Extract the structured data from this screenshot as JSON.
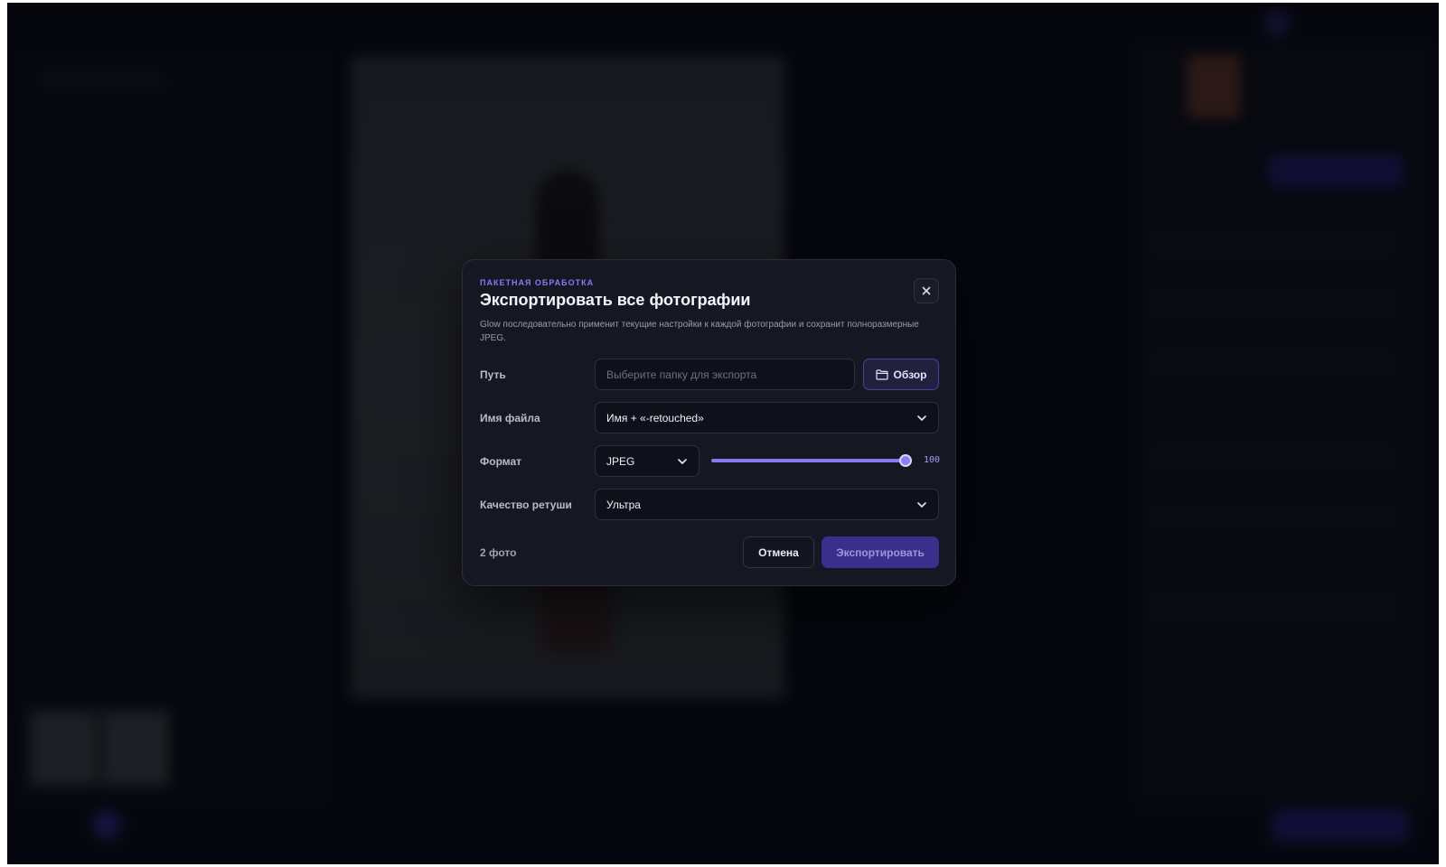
{
  "modal": {
    "eyebrow": "ПАКЕТНАЯ ОБРАБОТКА",
    "title": "Экспортировать все фотографии",
    "description": "Glow последовательно применит текущие настройки к каждой фотографии и сохранит полноразмерные JPEG.",
    "close_icon": "close-icon",
    "path": {
      "label": "Путь",
      "value": "",
      "placeholder": "Выберите папку для экспорта",
      "browse_label": "Обзор",
      "browse_icon": "folder-icon"
    },
    "filename": {
      "label": "Имя файла",
      "selected": "Имя + «-retouched»"
    },
    "format": {
      "label": "Формат",
      "selected": "JPEG",
      "quality_value": "100",
      "quality_fraction": 1.0
    },
    "retouch_quality": {
      "label": "Качество ретуши",
      "selected": "Ультра"
    },
    "footer": {
      "count": "2 фото",
      "cancel_label": "Отмена",
      "export_label": "Экспортировать"
    }
  },
  "colors": {
    "accent": "#8a78f0",
    "primary_button": "#3a2f8c",
    "modal_bg": "#151722",
    "app_bg": "#090b14"
  }
}
